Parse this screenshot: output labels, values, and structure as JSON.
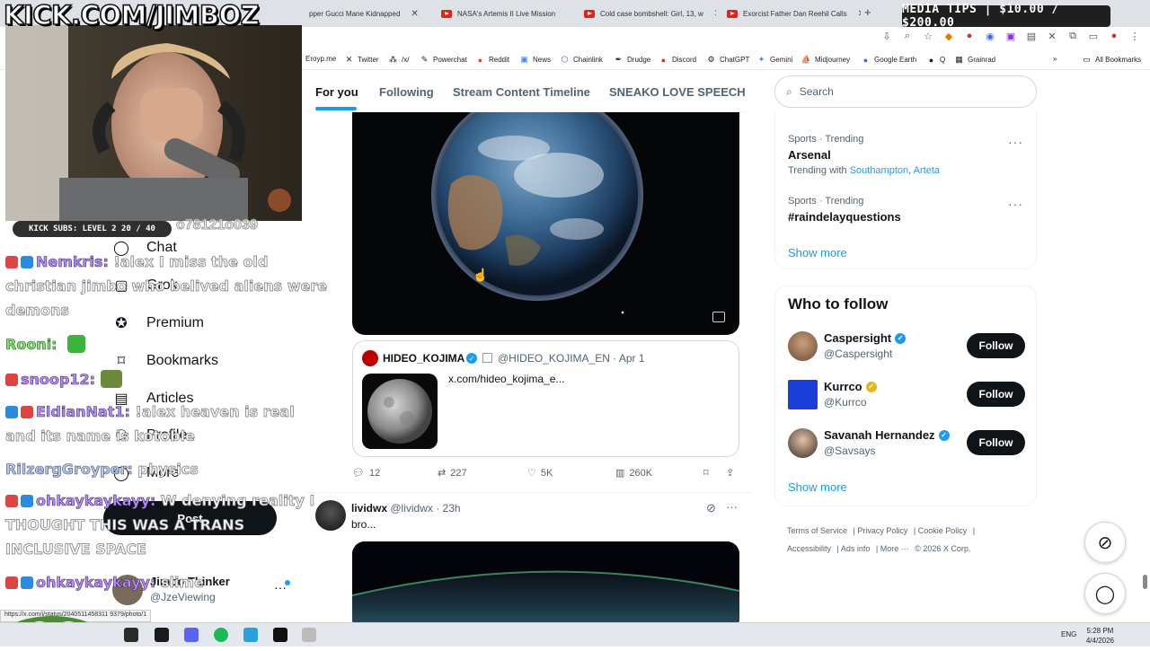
{
  "browser": {
    "tabs": [
      {
        "title": "pper Gucci Mane Kidnapped"
      },
      {
        "title": "NASA's Artemis II Live Mission"
      },
      {
        "title": "Cold case bombshell: Girl, 13, w"
      },
      {
        "title": "Exorcist Father Dan Reehil Calls"
      }
    ],
    "new_tab": "+",
    "bookmarks": [
      "Eroyp.me",
      "Twitter",
      "/x/",
      "Powerchat",
      "Reddit",
      "News",
      "Chainlink",
      "Drudge",
      "Discord",
      "ChatGPT",
      "Gemini",
      "Midjourney",
      "Google Earth",
      "Q",
      "Grainrad"
    ],
    "all_bookmarks": "All Bookmarks"
  },
  "overlay": {
    "media_tips": "MEDIA TIPS | $10.00 / $200.00",
    "kick_title": "KICK.COM/JIMBOZ",
    "subs_badge": "KICK SUBS: LEVEL 2 20 / 40",
    "handle_fragment": "o78121o039",
    "status_url": "https://x.com/i/status/2040511458311 9379/photo/1"
  },
  "chat": [
    {
      "user": "Nemkris:",
      "msg": "!alex I miss the old christian jimbo who belived aliens were demons",
      "color": "purple"
    },
    {
      "user": "Rooni:",
      "msg": "",
      "color": "purple"
    },
    {
      "user": "snoop12:",
      "msg": "",
      "color": "purple"
    },
    {
      "user": "EldianNat1:",
      "msg": "!alex heaven is real and its name is kotoble",
      "color": "purple"
    },
    {
      "user": "RilzergGroyper:",
      "msg": "physics",
      "color": "blue"
    },
    {
      "user": "ohkaykaykayy:",
      "msg": "W denying reality I THOUGHT THIS WAS A TRANS INCLUSIVE SPACE",
      "color": "purple"
    },
    {
      "user": "ohkaykaykayy:",
      "msg": "slime",
      "color": "purple"
    }
  ],
  "leftnav": {
    "items": [
      "Chat",
      "Grok",
      "Premium",
      "Bookmarks",
      "Articles",
      "Profile",
      "More"
    ],
    "post": "Post",
    "profile_name": "Jimbo Thinker",
    "profile_handle": "@JzeViewing"
  },
  "xtabs": [
    "For you",
    "Following",
    "Stream Content Timeline",
    "SNEAKO LOVE SPEECH"
  ],
  "feed": {
    "quote_author": "HIDEO_KOJIMA",
    "quote_handle": "@HIDEO_KOJIMA_EN · Apr 1",
    "quote_link": "x.com/hideo_kojima_e...",
    "actions": {
      "replies": "12",
      "reposts": "227",
      "likes": "5K",
      "views": "260K"
    },
    "post2": {
      "name": "lividwx",
      "handle": "@lividwx · 23h",
      "text": "bro..."
    }
  },
  "sidebar": {
    "search_placeholder": "Search",
    "trends": [
      {
        "category": "Sports · Trending",
        "name": "Arsenal",
        "with_prefix": "Trending with",
        "with_1": "Southampton",
        "with_sep": ",",
        "with_2": "Arteta"
      },
      {
        "category": "Sports · Trending",
        "name": "#raindelayquestions"
      }
    ],
    "show_more": "Show more",
    "who_to_follow": "Who to follow",
    "accounts": [
      {
        "name": "Caspersight",
        "handle": "@Caspersight",
        "button": "Follow"
      },
      {
        "name": "Kurrco",
        "handle": "@Kurrco",
        "button": "Follow"
      },
      {
        "name": "Savanah Hernandez",
        "handle": "@Savsays",
        "button": "Follow"
      }
    ],
    "footer": [
      "Terms of Service",
      "Privacy Policy",
      "Cookie Policy",
      "Accessibility",
      "Ads info",
      "More ···",
      "© 2026 X Corp."
    ]
  },
  "taskbar": {
    "lang": "ENG",
    "time": "5:28 PM",
    "date": "4/4/2026"
  },
  "colors": {
    "accent": "#1d9bf0",
    "text": "#0f1419",
    "muted": "#536471"
  }
}
